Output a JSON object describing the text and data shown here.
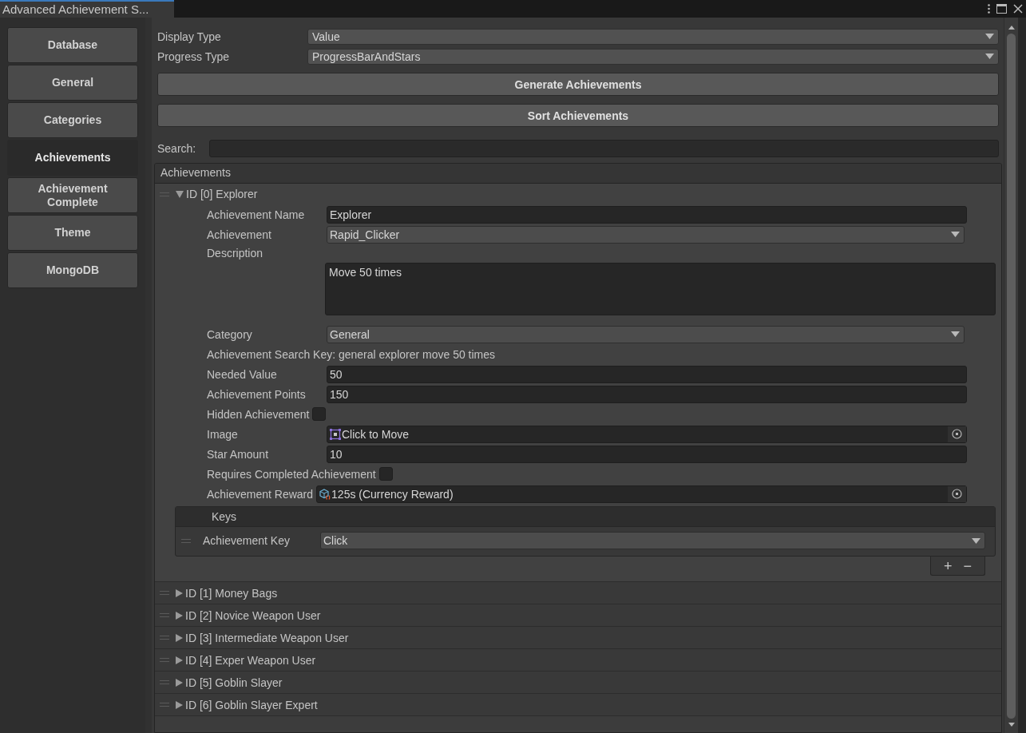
{
  "window": {
    "title": "Advanced Achievement S..."
  },
  "sidebar": {
    "items": [
      {
        "label": "Database",
        "selected": false
      },
      {
        "label": "General",
        "selected": false
      },
      {
        "label": "Categories",
        "selected": false
      },
      {
        "label": "Achievements",
        "selected": true
      },
      {
        "label": "Achievement Complete",
        "selected": false
      },
      {
        "label": "Theme",
        "selected": false
      },
      {
        "label": "MongoDB",
        "selected": false
      }
    ]
  },
  "settings": [
    {
      "label": "Display Type",
      "value": "Value"
    },
    {
      "label": "Progress Type",
      "value": "ProgressBarAndStars"
    }
  ],
  "actions": [
    "Generate Achievements",
    "Sort Achievements"
  ],
  "search": {
    "label": "Search:"
  },
  "achievements": {
    "title": "Achievements",
    "items": [
      {
        "title": "ID [0] Explorer",
        "expanded": true,
        "fields": [
          {
            "kind": "text",
            "label": "Achievement Name",
            "value": "Explorer"
          },
          {
            "kind": "dropdown",
            "label": "Achievement",
            "value": "Rapid_Clicker"
          },
          {
            "kind": "textarea",
            "label": "Description",
            "value": "Move 50 times"
          },
          {
            "kind": "dropdown",
            "label": "Category",
            "value": "General"
          },
          {
            "kind": "info",
            "label": "Achievement Search Key: general explorer move 50 times"
          },
          {
            "kind": "text",
            "label": "Needed Value",
            "value": "50"
          },
          {
            "kind": "text",
            "label": "Achievement Points",
            "value": "150"
          },
          {
            "kind": "checkbox",
            "label": "Hidden Achievement",
            "checked": false
          },
          {
            "kind": "sprite",
            "label": "Image",
            "value": "Click to Move"
          },
          {
            "kind": "text",
            "label": "Star Amount",
            "value": "10"
          },
          {
            "kind": "checkbox",
            "label": "Requires Completed Achievement",
            "checked": false
          },
          {
            "kind": "asset",
            "label": "Achievement Reward",
            "value": "125s (Currency Reward)"
          }
        ],
        "keys": {
          "title": "Keys",
          "items": [
            {
              "label": "Achievement Key",
              "value": "Click"
            }
          ],
          "buttons": [
            "+",
            "−"
          ]
        }
      },
      {
        "title": "ID [1] Money Bags",
        "expanded": false
      },
      {
        "title": "ID [2] Novice Weapon User",
        "expanded": false
      },
      {
        "title": "ID [3] Intermediate Weapon User",
        "expanded": false
      },
      {
        "title": "ID [4] Exper Weapon User",
        "expanded": false
      },
      {
        "title": "ID [5] Goblin Slayer",
        "expanded": false
      },
      {
        "title": "ID [6] Goblin Slayer Expert",
        "expanded": false
      }
    ]
  }
}
